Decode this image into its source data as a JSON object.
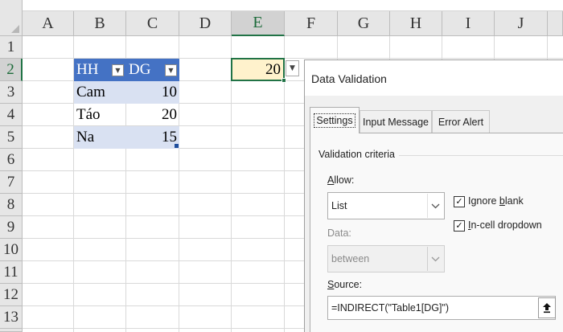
{
  "sheet": {
    "columns": [
      "A",
      "B",
      "C",
      "D",
      "E",
      "F",
      "G",
      "H",
      "I",
      "J"
    ],
    "rows": [
      "1",
      "2",
      "3",
      "4",
      "5",
      "6",
      "7",
      "8",
      "9",
      "10",
      "11",
      "12",
      "13"
    ],
    "selected_column": "E",
    "selected_row": "2",
    "table": {
      "headers": [
        "HH",
        "DG"
      ],
      "rows": [
        [
          "Cam",
          "10"
        ],
        [
          "Táo",
          "20"
        ],
        [
          "Na",
          "15"
        ]
      ],
      "header_color": "#4472c4",
      "band_color": "#d9e1f2"
    },
    "active_cell": {
      "value": "20",
      "fill_color": "#fff2cc"
    },
    "filter_icon": "dropdown-triangle-icon",
    "validation_dropdown_icon": "dropdown-triangle-icon"
  },
  "dialog": {
    "title": "Data Validation",
    "tabs": [
      "Settings",
      "Input Message",
      "Error Alert"
    ],
    "active_tab": "Settings",
    "validation_criteria_label": "Validation criteria",
    "allow_label_prefix": "A",
    "allow_label_rest": "llow:",
    "allow_value": "List",
    "data_label": "Data:",
    "data_value": "between",
    "ignore_blank_prefix": "Ignore ",
    "ignore_blank_underlined": "b",
    "ignore_blank_rest": "lank",
    "ignore_blank_checked": true,
    "incell_prefix": "",
    "incell_underlined": "I",
    "incell_rest": "n-cell dropdown",
    "incell_checked": true,
    "source_label_prefix": "",
    "source_label_underlined": "S",
    "source_label_rest": "ource:",
    "source_value": "=INDIRECT(\"Table1[DG]\")",
    "ref_button_icon": "collapse-dialog-icon",
    "check_glyph": "✓"
  },
  "colors": {
    "excel_green": "#217346"
  }
}
